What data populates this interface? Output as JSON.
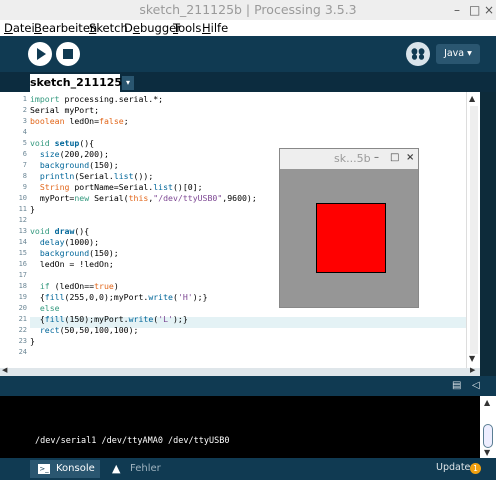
{
  "window": {
    "title": "sketch_211125b | Processing 3.5.3",
    "minimize": "–",
    "maximize": "□",
    "close": "×"
  },
  "menu": [
    {
      "underline": "D",
      "rest": "atei"
    },
    {
      "underline": "B",
      "rest": "earbeiten"
    },
    {
      "underline": "S",
      "rest": "ketch"
    },
    {
      "underline": "",
      "rest": "D",
      "underline2": "e",
      "rest2": "bugger"
    },
    {
      "underline": "T",
      "rest": "ools"
    },
    {
      "underline": "H",
      "rest": "ilfe"
    }
  ],
  "toolbar": {
    "mode": "Java ▾"
  },
  "tab": {
    "label": "sketch_211125b",
    "menu": "▾"
  },
  "editor": {
    "line_numbers": [
      "1",
      "2",
      "3",
      "4",
      "5",
      "6",
      "7",
      "8",
      "9",
      "10",
      "11",
      "12",
      "13",
      "14",
      "15",
      "16",
      "17",
      "18",
      "19",
      "20",
      "21",
      "22",
      "23",
      "24"
    ],
    "active_line": "21"
  },
  "sketch_window": {
    "title": "sk...5b",
    "minimize": "–",
    "maximize": "□",
    "close": "×"
  },
  "console": {
    "output": "/dev/serial1 /dev/ttyAMA0 /dev/ttyUSB0"
  },
  "footer": {
    "console_tab": "Konsole",
    "errors_tab": "Fehler",
    "updates": "Updates",
    "updates_count": "1"
  }
}
